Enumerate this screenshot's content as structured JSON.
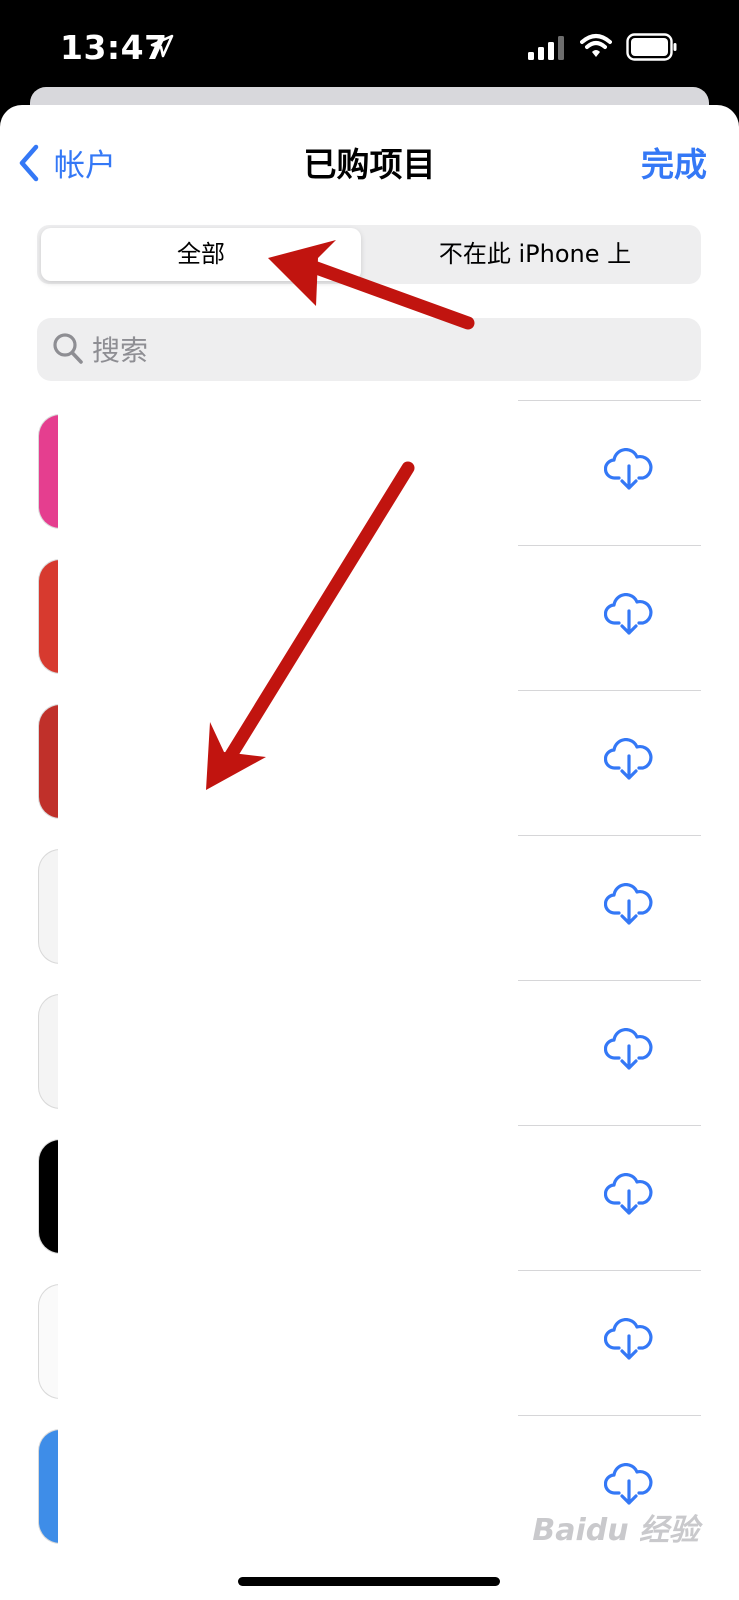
{
  "status_bar": {
    "time": "13:47",
    "icons": [
      "location-arrow-icon",
      "signal-icon",
      "wifi-icon",
      "battery-icon"
    ]
  },
  "nav": {
    "back_label": "帐户",
    "title": "已购项目",
    "done_label": "完成"
  },
  "segmented": {
    "options": [
      "全部",
      "不在此 iPhone 上"
    ],
    "selected": "全部"
  },
  "search": {
    "placeholder": "搜索"
  },
  "list": {
    "rows": [
      {
        "icon_color": "#e53e8f",
        "action": "cloud-download-icon"
      },
      {
        "icon_color": "#d73a2f",
        "action": "cloud-download-icon"
      },
      {
        "icon_color": "#c0302a",
        "action": "cloud-download-icon"
      },
      {
        "icon_color": "#f4f4f4",
        "action": "cloud-download-icon"
      },
      {
        "icon_color": "#f4f4f4",
        "action": "cloud-download-icon"
      },
      {
        "icon_color": "#000000",
        "action": "cloud-download-icon"
      },
      {
        "icon_color": "#fafafa",
        "action": "cloud-download-icon"
      },
      {
        "icon_color": "#3e8de8",
        "action": "cloud-download-icon"
      }
    ]
  },
  "colors": {
    "accent": "#3478f6",
    "annotation_arrow": "#c1140f"
  },
  "watermark": "Baidu 经验"
}
